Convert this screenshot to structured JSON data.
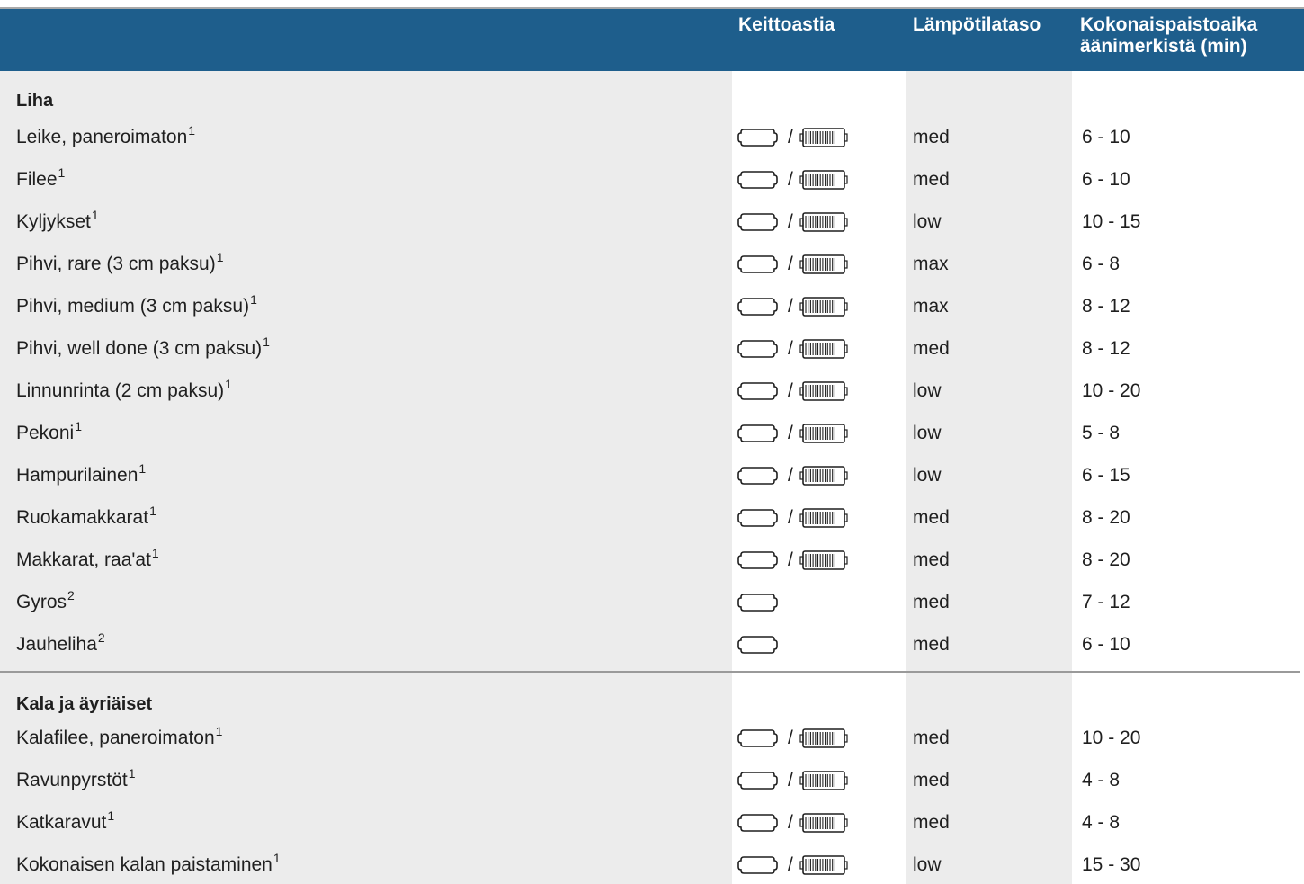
{
  "header": {
    "col_cookware": "Keittoastia",
    "col_temp": "Lämpötilataso",
    "col_time_line1": "Kokonaispaistoaika",
    "col_time_line2": "äänimerkistä (min)"
  },
  "icons": {
    "pan": "frying-pan-icon",
    "grill": "grill-plate-icon",
    "separator": "/"
  },
  "sections": [
    {
      "title": "Liha",
      "rows": [
        {
          "name": "Leike, paneroimaton",
          "note": "1",
          "cookware": "pan-grill",
          "temp": "med",
          "time": "6 - 10"
        },
        {
          "name": "Filee",
          "note": "1",
          "cookware": "pan-grill",
          "temp": "med",
          "time": "6 - 10"
        },
        {
          "name": "Kyljykset",
          "note": "1",
          "cookware": "pan-grill",
          "temp": "low",
          "time": "10 - 15"
        },
        {
          "name": "Pihvi, rare (3 cm paksu)",
          "note": "1",
          "cookware": "pan-grill",
          "temp": "max",
          "time": "6 - 8"
        },
        {
          "name": "Pihvi, medium (3 cm paksu)",
          "note": "1",
          "cookware": "pan-grill",
          "temp": "max",
          "time": "8 - 12"
        },
        {
          "name": "Pihvi, well done (3 cm paksu)",
          "note": "1",
          "cookware": "pan-grill",
          "temp": "med",
          "time": "8 - 12"
        },
        {
          "name": "Linnunrinta (2 cm paksu)",
          "note": "1",
          "cookware": "pan-grill",
          "temp": "low",
          "time": "10 - 20"
        },
        {
          "name": "Pekoni",
          "note": "1",
          "cookware": "pan-grill",
          "temp": "low",
          "time": "5 - 8"
        },
        {
          "name": "Hampurilainen",
          "note": "1",
          "cookware": "pan-grill",
          "temp": "low",
          "time": "6 - 15"
        },
        {
          "name": "Ruokamakkarat",
          "note": "1",
          "cookware": "pan-grill",
          "temp": "med",
          "time": "8 - 20"
        },
        {
          "name": "Makkarat, raa'at",
          "note": "1",
          "cookware": "pan-grill",
          "temp": "med",
          "time": "8 - 20"
        },
        {
          "name": "Gyros",
          "note": "2",
          "cookware": "pan",
          "temp": "med",
          "time": "7 - 12"
        },
        {
          "name": "Jauheliha",
          "note": "2",
          "cookware": "pan",
          "temp": "med",
          "time": "6 - 10"
        }
      ]
    },
    {
      "title": "Kala ja äyriäiset",
      "rows": [
        {
          "name": "Kalafilee, paneroimaton",
          "note": "1",
          "cookware": "pan-grill",
          "temp": "med",
          "time": "10 - 20"
        },
        {
          "name": "Ravunpyrstöt",
          "note": "1",
          "cookware": "pan-grill",
          "temp": "med",
          "time": "4 - 8"
        },
        {
          "name": "Katkaravut",
          "note": "1",
          "cookware": "pan-grill",
          "temp": "med",
          "time": "4 - 8"
        },
        {
          "name": "Kokonaisen kalan paistaminen",
          "note": "1",
          "cookware": "pan-grill",
          "temp": "low",
          "time": "15 - 30"
        }
      ]
    }
  ]
}
